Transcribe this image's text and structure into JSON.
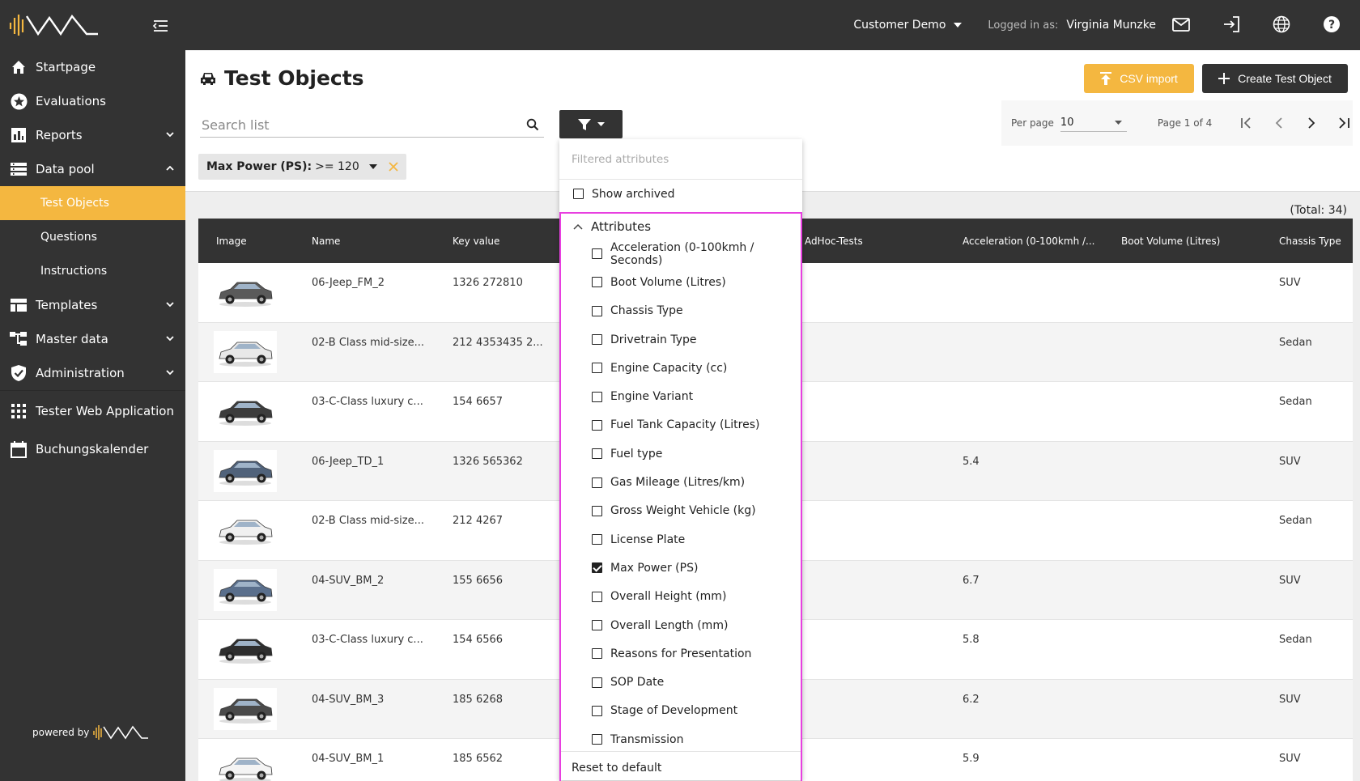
{
  "brand": {
    "accent": "#f4b740",
    "dark": "#333333",
    "highlight": "#e83fe0"
  },
  "sidebar": {
    "items": [
      {
        "label": "Startpage",
        "icon": "home-icon"
      },
      {
        "label": "Evaluations",
        "icon": "star-icon"
      },
      {
        "label": "Reports",
        "icon": "bar-chart-icon"
      },
      {
        "label": "Data pool",
        "icon": "list-icon"
      },
      {
        "label": "Templates",
        "icon": "template-icon"
      },
      {
        "label": "Master data",
        "icon": "hierarchy-icon"
      },
      {
        "label": "Administration",
        "icon": "shield-check-icon"
      },
      {
        "label": "Tester Web Application",
        "icon": "grid-icon"
      },
      {
        "label": "Buchungskalender",
        "icon": "calendar-icon"
      }
    ],
    "data_pool_children": [
      "Test Objects",
      "Questions",
      "Instructions"
    ],
    "powered_by": "powered by"
  },
  "topbar": {
    "tenant": "Customer Demo",
    "logged_label": "Logged in as:",
    "logged_user": "Virginia Munzke"
  },
  "page": {
    "title": "Test Objects",
    "csv_import": "CSV import",
    "create": "Create Test Object",
    "search_placeholder": "Search list",
    "chip_label": "Max Power (PS):",
    "chip_value": ">= 120",
    "per_page_label": "Per page",
    "per_page_value": "10",
    "page_info": "Page 1 of 4",
    "total": "(Total: 34)"
  },
  "table": {
    "headers": [
      "Image",
      "Name",
      "Key value",
      "AdHoc-Tests",
      "Acceleration (0-100kmh /...",
      "Boot Volume (Litres)",
      "Chassis Type"
    ],
    "rows": [
      {
        "name": "06-Jeep_FM_2",
        "key": "1326 272810",
        "adhoc": "",
        "accel": "",
        "boot": "",
        "chassis": "SUV"
      },
      {
        "name": "02-B Class mid-size...",
        "key": "212 4353435 2...",
        "adhoc": "",
        "accel": "",
        "boot": "",
        "chassis": "Sedan"
      },
      {
        "name": "03-C-Class luxury c...",
        "key": "154 6657",
        "adhoc": "",
        "accel": "",
        "boot": "",
        "chassis": "Sedan"
      },
      {
        "name": "06-Jeep_TD_1",
        "key": "1326 565362",
        "adhoc": "",
        "accel": "5.4",
        "boot": "",
        "chassis": "SUV"
      },
      {
        "name": "02-B Class mid-size...",
        "key": "212 4267",
        "adhoc": "",
        "accel": "",
        "boot": "",
        "chassis": "Sedan"
      },
      {
        "name": "04-SUV_BM_2",
        "key": "155 6656",
        "adhoc": "",
        "accel": "6.7",
        "boot": "",
        "chassis": "SUV"
      },
      {
        "name": "03-C-Class luxury c...",
        "key": "154 6566",
        "adhoc": "",
        "accel": "5.8",
        "boot": "",
        "chassis": "Sedan"
      },
      {
        "name": "04-SUV_BM_3",
        "key": "185 6268",
        "adhoc": "",
        "accel": "6.2",
        "boot": "",
        "chassis": "SUV"
      },
      {
        "name": "04-SUV_BM_1",
        "key": "185 6562",
        "adhoc": "",
        "accel": "5.9",
        "boot": "",
        "chassis": "SUV"
      }
    ]
  },
  "dropdown": {
    "placeholder": "Filtered attributes",
    "show_archived": "Show archived",
    "attributes_label": "Attributes",
    "attributes": [
      {
        "label": "Acceleration (0-100kmh / Seconds)",
        "checked": false
      },
      {
        "label": "Boot Volume (Litres)",
        "checked": false
      },
      {
        "label": "Chassis Type",
        "checked": false
      },
      {
        "label": "Drivetrain Type",
        "checked": false
      },
      {
        "label": "Engine Capacity (cc)",
        "checked": false
      },
      {
        "label": "Engine Variant",
        "checked": false
      },
      {
        "label": "Fuel Tank Capacity (Litres)",
        "checked": false
      },
      {
        "label": "Fuel type",
        "checked": false
      },
      {
        "label": "Gas Mileage (Litres/km)",
        "checked": false
      },
      {
        "label": "Gross Weight Vehicle (kg)",
        "checked": false
      },
      {
        "label": "License Plate",
        "checked": false
      },
      {
        "label": "Max Power (PS)",
        "checked": true
      },
      {
        "label": "Overall Height (mm)",
        "checked": false
      },
      {
        "label": "Overall Length (mm)",
        "checked": false
      },
      {
        "label": "Reasons for Presentation",
        "checked": false
      },
      {
        "label": "SOP Date",
        "checked": false
      },
      {
        "label": "Stage of Development",
        "checked": false
      },
      {
        "label": "Transmission",
        "checked": false
      }
    ],
    "reset": "Reset to default"
  }
}
